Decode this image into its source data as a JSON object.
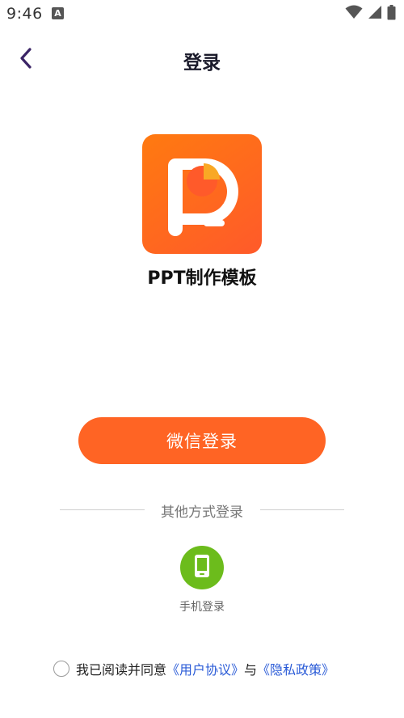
{
  "status_bar": {
    "time": "9:46",
    "app_icon_letter": "A"
  },
  "header": {
    "title": "登录"
  },
  "app": {
    "name": "PPT制作模板",
    "logo_colors": {
      "top": "#ff7a10",
      "bottom": "#ff5a2a",
      "accent": "#f9a825"
    }
  },
  "wechat_login": {
    "label": "微信登录",
    "color": "#ff6424"
  },
  "other_methods": {
    "label": "其他方式登录",
    "phone_label": "手机登录",
    "phone_color": "#6cbc1c"
  },
  "agreement": {
    "prefix": "我已阅读并同意",
    "user_agreement": "《用户协议》",
    "conjunction": "与",
    "privacy_policy": "《隐私政策》",
    "checked": false
  },
  "icons": {
    "back": "chevron-left-icon",
    "wifi": "wifi-icon",
    "signal": "signal-icon",
    "battery": "battery-icon",
    "phone": "phone-icon"
  }
}
